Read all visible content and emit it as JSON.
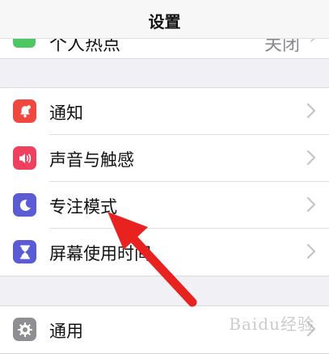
{
  "header": {
    "title": "设置"
  },
  "cropped_row": {
    "label": "个人热点",
    "value": "关闭"
  },
  "groups": [
    {
      "items": [
        {
          "label": "通知",
          "icon": "bell-icon",
          "icon_color": "#f0483e"
        },
        {
          "label": "声音与触感",
          "icon": "speaker-icon",
          "icon_color": "#f0405f"
        },
        {
          "label": "专注模式",
          "icon": "moon-icon",
          "icon_color": "#5b5bd6"
        },
        {
          "label": "屏幕使用时间",
          "icon": "hourglass-icon",
          "icon_color": "#5b5bd6"
        }
      ]
    },
    {
      "items": [
        {
          "label": "通用",
          "icon": "gear-icon",
          "icon_color": "#8e8e93"
        }
      ]
    }
  ],
  "annotation": {
    "arrow_color": "#e8231f",
    "watermark": "Baidu经验"
  }
}
